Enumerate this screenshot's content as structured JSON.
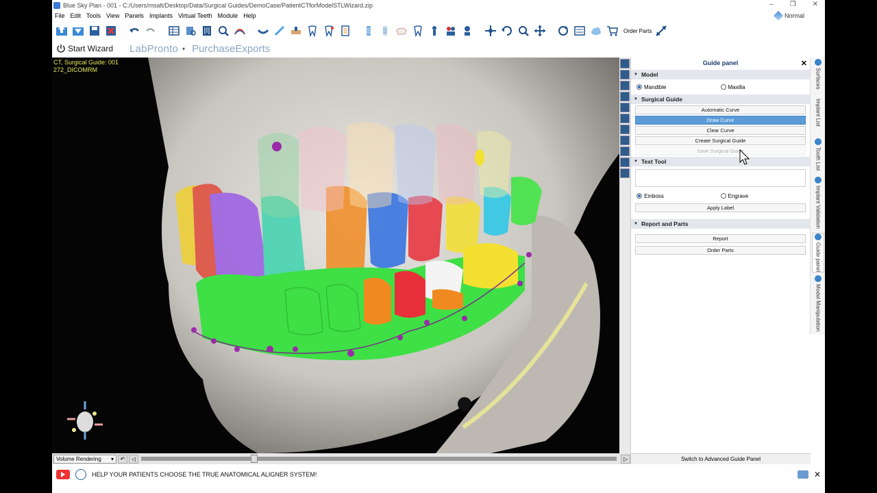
{
  "window": {
    "title": "Blue Sky Plan - 001 - C:/Users/msalt/Desktop/Data/Surgical Guides/DemoCase/PatientCTforModelSTLWizard.zip",
    "minimize": "–",
    "restore": "❐",
    "close": "✕"
  },
  "menu": [
    "File",
    "Edit",
    "Tools",
    "View",
    "Panels",
    "Implants",
    "Virtual Teeth",
    "Module",
    "Help"
  ],
  "mode": "Normal",
  "toolbar": {
    "order_parts": "Order Parts"
  },
  "wizard_bar": {
    "start_wizard": "Start Wizard",
    "labpronto": "LabPronto",
    "purchase_exports": "PurchaseExports"
  },
  "viewport": {
    "line1": "CT, Surgical Guide: 001",
    "line2": "272_DICOMRM",
    "render_mode": "Volume Rendering",
    "slider_value": 0.23
  },
  "panel": {
    "title": "Guide panel",
    "close": "✕",
    "model": {
      "header": "Model",
      "options": [
        "Mandible",
        "Maxilla"
      ],
      "selected": "Mandible"
    },
    "surgical_guide": {
      "header": "Surgical Guide",
      "automatic_curve": "Automatic Curve",
      "draw_curve": "Draw Curve",
      "clear_curve": "Clear Curve",
      "create_surgical_guide": "Create Surgical Guide",
      "save_surgical_guide": "Save Surgical Guide"
    },
    "text_tool": {
      "header": "Text Tool",
      "text_value": "",
      "options": [
        "Emboss",
        "Engrave"
      ],
      "selected": "Emboss",
      "apply_label": "Apply Label"
    },
    "report_parts": {
      "header": "Report and Parts",
      "report": "Report",
      "order_parts": "Order Parts"
    },
    "advanced": "Switch to Advanced Guide Panel"
  },
  "side_tabs": [
    "Surfaces",
    "Implant List",
    "Tooth List",
    "Implant Validation",
    "Guide panel",
    "Model Manipulation"
  ],
  "notification": {
    "text": "HELP YOUR PATIENTS CHOOSE THE TRUE ANATOMICAL ALIGNER SYSTEM!"
  },
  "colors": {
    "accent": "#5b9bd8",
    "viewport_text": "#e8e85a",
    "section_bg": "#e3e6ec",
    "teeth": [
      "#f0d030",
      "#e04a3a",
      "#9b5de5",
      "#3fd4b0",
      "#f08a20",
      "#2f6fe0",
      "#e8303a",
      "#f4e030",
      "#28c8e8",
      "#3ce840"
    ],
    "guide_green": "#3ee045"
  },
  "icons": [
    "arrow-up-icon",
    "arrow-down-icon",
    "save-icon",
    "close-red-icon",
    "undo-icon",
    "redo-icon",
    "grid-icon",
    "book-icon",
    "ruler-icon",
    "search-icon",
    "nerve-icon",
    "ruler2-icon",
    "scalpel-icon",
    "bone-icon",
    "tooth-icon",
    "pin-icon",
    "list-icon",
    "implant-icon",
    "implant2-icon",
    "crown-icon",
    "tooth2-icon",
    "screw-icon",
    "people-icon",
    "person-icon",
    "move-icon",
    "rotate-icon",
    "zoom-icon",
    "pan-icon",
    "refresh-icon",
    "fit-icon",
    "cloud-icon",
    "cart-icon",
    "expand-icon"
  ]
}
